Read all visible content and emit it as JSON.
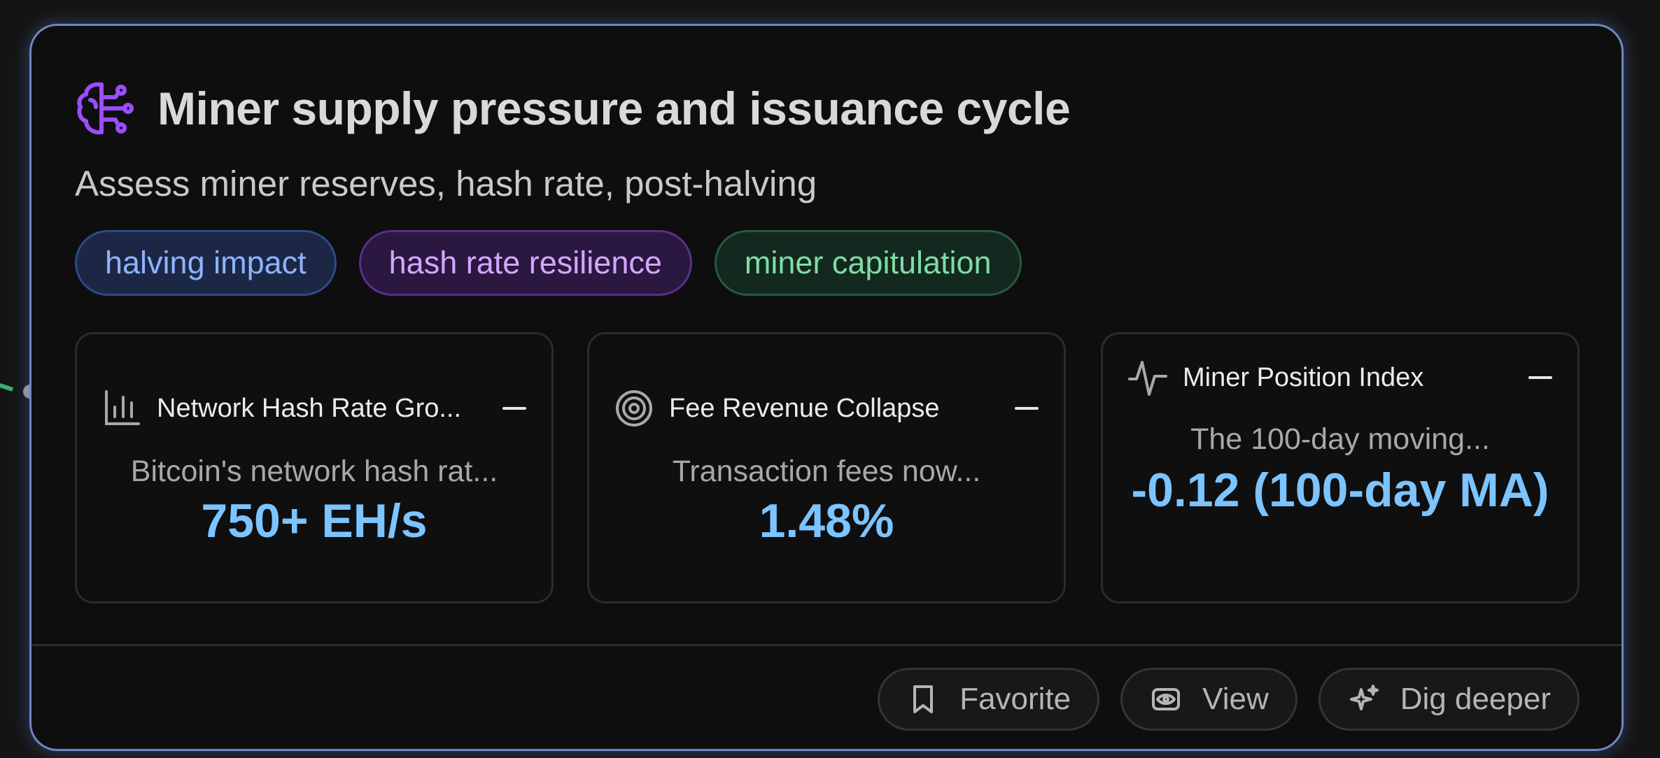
{
  "card": {
    "title": "Miner supply pressure and issuance cycle",
    "subtitle": "Assess miner reserves, hash rate, post-halving",
    "title_icon": "brain-icon",
    "accent_color": "#6e86c4"
  },
  "tags": [
    {
      "label": "halving impact",
      "color": "#8fb3ff"
    },
    {
      "label": "hash rate resilience",
      "color": "#d5a6ff"
    },
    {
      "label": "miner capitulation",
      "color": "#7fdca4"
    }
  ],
  "metrics": [
    {
      "icon": "bar-chart-icon",
      "label": "Network Hash Rate Gro...",
      "description": "Bitcoin's network hash rat...",
      "value": "750+ EH/s"
    },
    {
      "icon": "target-icon",
      "label": "Fee Revenue Collapse",
      "description": "Transaction fees now...",
      "value": "1.48%"
    },
    {
      "icon": "activity-icon",
      "label": "Miner Position Index",
      "description": "The 100-day moving...",
      "value": "-0.12 (100-day MA)"
    }
  ],
  "actions": {
    "favorite": "Favorite",
    "view": "View",
    "dig_deeper": "Dig deeper"
  }
}
